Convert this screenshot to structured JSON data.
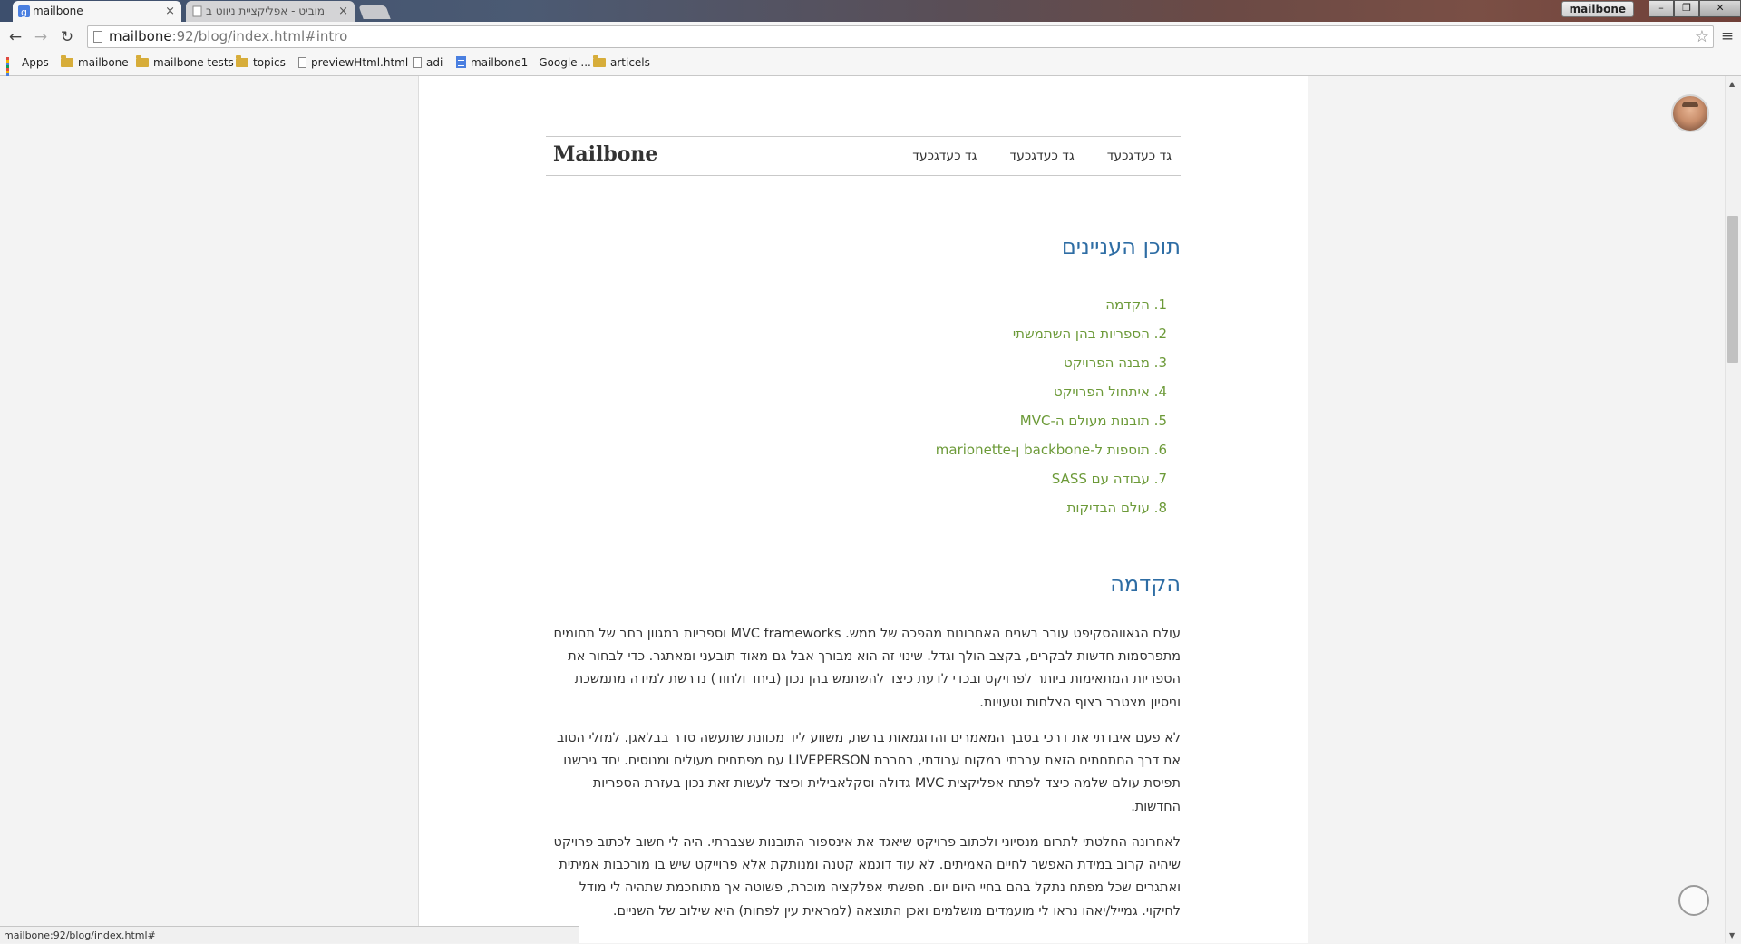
{
  "browser": {
    "tabs": [
      {
        "title": "mailbone",
        "active": true
      },
      {
        "title": "מוביט - אפליקציית ניווט ב",
        "active": false
      }
    ],
    "user_badge": "mailbone",
    "url_host": "mailbone",
    "url_path": ":92/blog/index.html#intro",
    "bookmarks": [
      "Apps",
      "mailbone",
      "mailbone tests",
      "topics",
      "previewHtml.html",
      "adi",
      "mailbone1 - Google ...",
      "articels"
    ],
    "status_text": "mailbone:92/blog/index.html#"
  },
  "site": {
    "brand": "Mailbone",
    "nav": [
      "גד כעדגכעד",
      "גד כעדגכעד",
      "גד כעדגכעד"
    ],
    "toc_title": "תוכן העניינים",
    "toc": [
      "1. הקדמה",
      "2. הספריות בהן השתמשתי",
      "3. מבנה הפרויקט",
      "4. איתחול הפרויקט",
      "5. תובנות מעולם ה-MVC",
      "6. תוספות ל-backbone ן-marionette",
      "7. עבודה עם SASS",
      "8. עולם הבדיקות"
    ],
    "intro_title": "הקדמה",
    "paragraphs": [
      "עולם הגאווהסקיפט עובר בשנים האחרונות מהפכה של ממש. MVC frameworks וספריות במגוון רחב של תחומים מתפרסמות חדשות לבקרים, בקצב הולך וגדל. שינוי זה הוא מבורך אבל גם מאוד תובעני ומאתגר. כדי לבחור את הספריות המתאימות ביותר לפרויקט ובכדי לדעת כיצד להשתמש בהן נכון (ביחד ולחוד) נדרשת למידה מתמשכת וניסיון מצטבר רצוף הצלחות וטעויות.",
      "לא פעם איבדתי את דרכי בסבך המאמרים והדוגמאות ברשת, משווע ליד מכוונת שתעשה סדר בבלאגן. למזלי הטוב את דרך החתחתים הזאת עברתי במקום עבודתי, בחברת LIVEPERSON עם מפתחים מעולים ומנוסים. יחד גיבשנו תפיסת עולם שלמה כיצד לפתח אפליקצית MVC גדולה וסקלאבילית וכיצד לעשות זאת נכון בעזרת הספריות החדשות.",
      "לאחרונה החלטתי לתרום מנסיוני ולכתוב פרויקט שיאגד את אינספור התובנות שצברתי. היה לי חשוב לכתוב פרויקט שיהיה קרוב במידת האפשר לחיים האמיתים. לא עוד דוגמא קטנה ומנותקת אלא פרוייקט שיש בו מורכבות אמיתית ואתגרים שכל מפתח נתקל בהם בחיי היום יום. חפשתי אפלקציה מוכרת, פשוטה אך מתוחכמת שתהיה לי מודל לחיקוי. גמייל/יאהו נראו לי מועמדים מושלמים ואכן התוצאה (למראית עין לפחות) היא שילוב של השניים."
    ]
  },
  "colors": {
    "link_green": "#6c9a38",
    "heading_blue": "#2e6da4"
  }
}
